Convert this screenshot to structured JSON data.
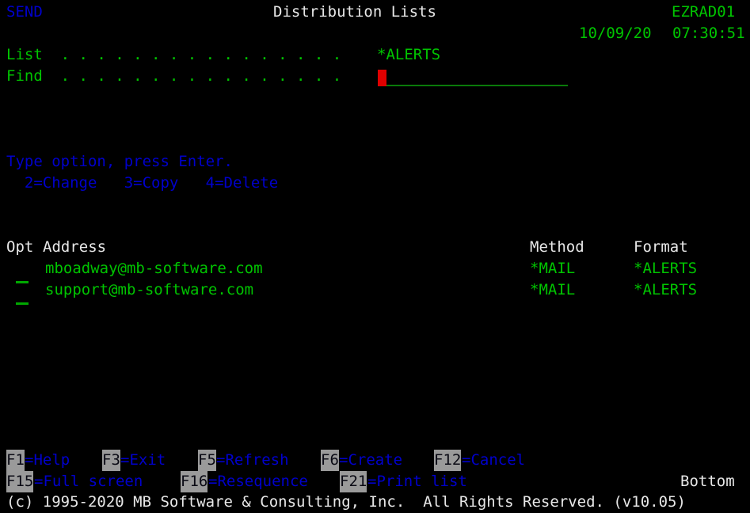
{
  "screen": {
    "program_id": "SEND",
    "title": "Distribution Lists",
    "screen_id": "EZRAD01",
    "date": "10/09/20",
    "time": "07:30:51",
    "background_color": "#000000",
    "green": "#00c400",
    "white": "#e8e8e8",
    "blue": "#0000cc",
    "cursor_color": "#e00000"
  },
  "fields": {
    "list_label": "List  . . . . . . . . . . . . . . . .",
    "list_value": "*ALERTS",
    "find_label": "Find  . . . . . . . . . . . . . . . .",
    "find_value": "",
    "find_placeholder": ""
  },
  "instructions": {
    "prompt": "Type option, press Enter.",
    "options": "  2=Change   3=Copy   4=Delete",
    "option_list": [
      {
        "code": "2",
        "label": "Change"
      },
      {
        "code": "3",
        "label": "Copy"
      },
      {
        "code": "4",
        "label": "Delete"
      }
    ]
  },
  "table": {
    "headers": {
      "opt": "Opt",
      "address": "Address",
      "method": "Method",
      "format": "Format"
    },
    "rows": [
      {
        "opt": "",
        "address": "mboadway@mb-software.com",
        "method": "*MAIL",
        "format": "*ALERTS"
      },
      {
        "opt": "",
        "address": "support@mb-software.com",
        "method": "*MAIL",
        "format": "*ALERTS"
      }
    ]
  },
  "function_keys": {
    "row1": [
      {
        "key": "F1",
        "label": "=Help"
      },
      {
        "key": "F3",
        "label": "=Exit"
      },
      {
        "key": "F5",
        "label": "=Refresh"
      },
      {
        "key": "F6",
        "label": "=Create"
      },
      {
        "key": "F12",
        "label": "=Cancel"
      }
    ],
    "row2": [
      {
        "key": "F15",
        "label": "=Full screen"
      },
      {
        "key": "F16",
        "label": "=Resequence"
      },
      {
        "key": "F21",
        "label": "=Print list"
      }
    ]
  },
  "status": {
    "position": "Bottom",
    "copyright": "(c) 1995-2020 MB Software & Consulting, Inc.  All Rights Reserved. (v10.05)"
  }
}
